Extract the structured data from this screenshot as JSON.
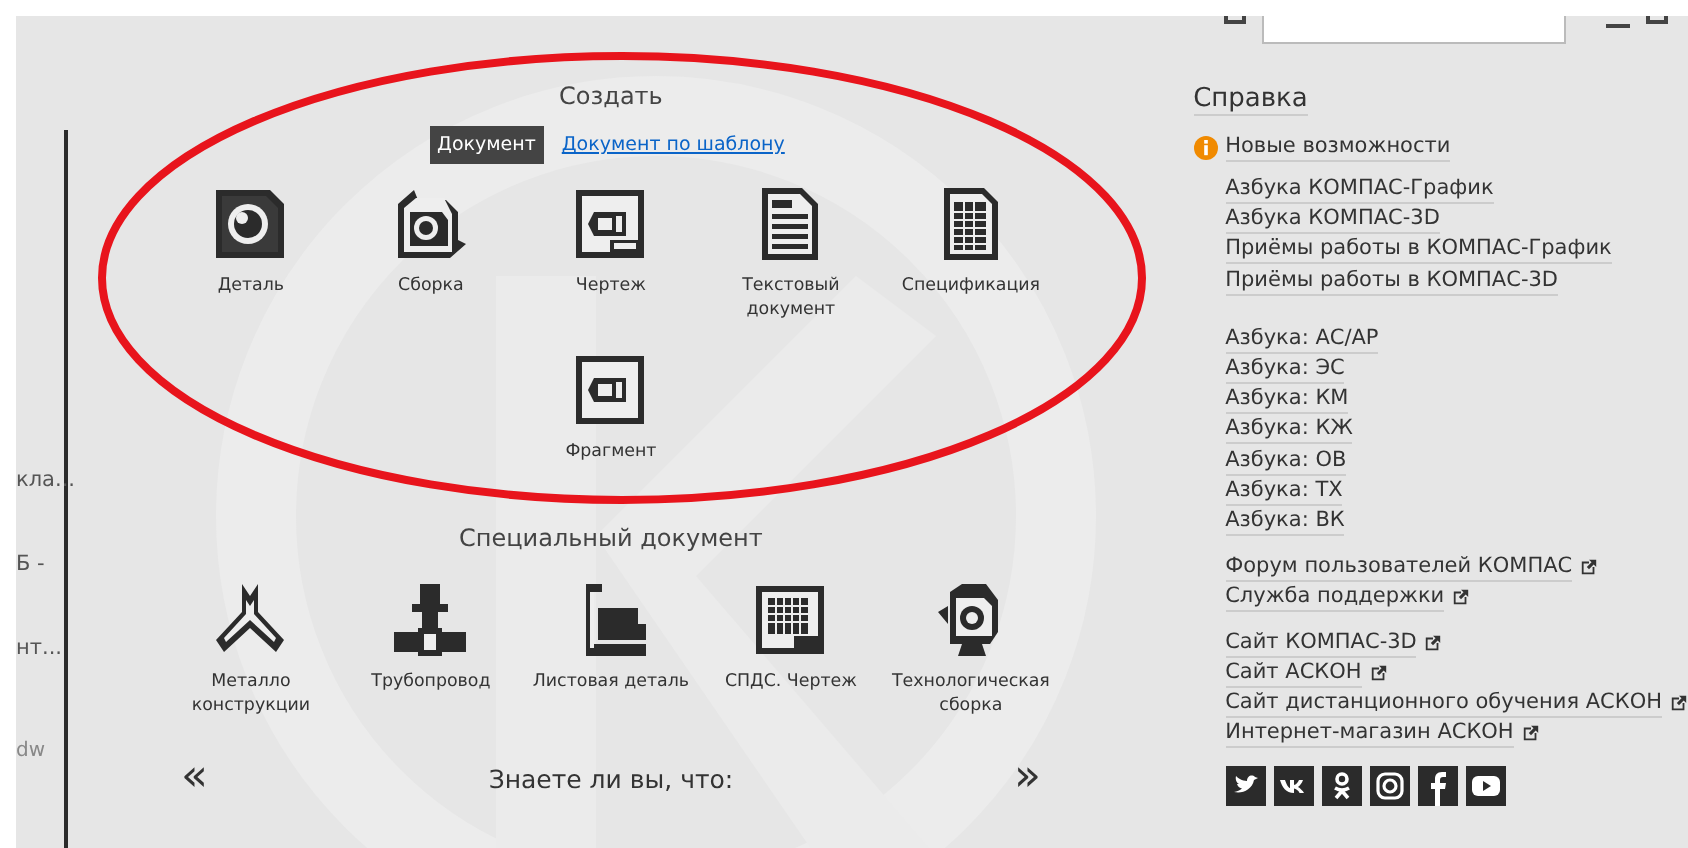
{
  "left_pane": {
    "items": [
      "кла...",
      "Б -",
      "нт...",
      "dw"
    ]
  },
  "create": {
    "title": "Создать",
    "tabs": [
      {
        "label": "Документ",
        "selected": true
      },
      {
        "label": "Документ по шаблону",
        "selected": false
      }
    ],
    "items": [
      {
        "label": "Деталь"
      },
      {
        "label": "Сборка"
      },
      {
        "label": "Чертеж"
      },
      {
        "label": "Текстовый документ"
      },
      {
        "label": "Спецификация"
      },
      {
        "label": "Фрагмент"
      }
    ]
  },
  "special": {
    "title": "Специальный документ",
    "items": [
      {
        "label": "Металло конструкции"
      },
      {
        "label": "Трубопровод"
      },
      {
        "label": "Листовая деталь"
      },
      {
        "label": "СПДС. Чертеж"
      },
      {
        "label": "Технологическая сборка"
      }
    ]
  },
  "tips": {
    "title": "Знаете ли вы, что:",
    "prev": "«",
    "next": "»"
  },
  "help": {
    "title": "Справка",
    "new_features": "Новые возможности",
    "groups": [
      [
        {
          "label": "Азбука КОМПАС-График",
          "external": false
        },
        {
          "label": "Азбука КОМПАС-3D",
          "external": false
        },
        {
          "label": "Приёмы работы в КОМПАС-График",
          "external": false
        },
        {
          "label": "Приёмы работы в КОМПАС-3D",
          "external": false
        }
      ],
      [
        {
          "label": "Азбука: АС/АР",
          "external": false
        },
        {
          "label": "Азбука: ЭС",
          "external": false
        },
        {
          "label": "Азбука: КМ",
          "external": false
        },
        {
          "label": "Азбука: КЖ",
          "external": false
        },
        {
          "label": "Азбука: ОВ",
          "external": false
        },
        {
          "label": "Азбука: ТХ",
          "external": false
        },
        {
          "label": "Азбука: ВК",
          "external": false
        }
      ],
      [
        {
          "label": "Форум пользователей КОМПАС",
          "external": true
        },
        {
          "label": "Служба поддержки",
          "external": true
        }
      ],
      [
        {
          "label": "Сайт КОМПАС-3D",
          "external": true
        },
        {
          "label": "Сайт АСКОН",
          "external": true
        },
        {
          "label": "Сайт дистанционного обучения АСКОН",
          "external": true
        },
        {
          "label": "Интернет-магазин АСКОН",
          "external": true
        }
      ]
    ]
  },
  "annotation": {
    "kind": "ellipse"
  }
}
